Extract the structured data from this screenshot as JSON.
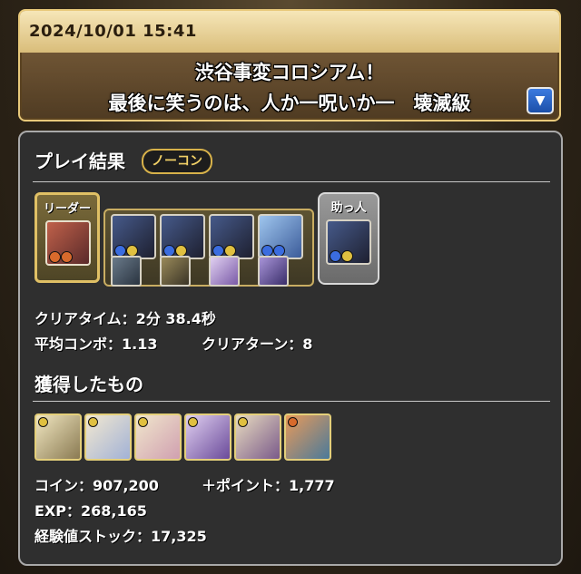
{
  "header": {
    "timestamp": "2024/10/01 15:41",
    "title_line1": "渋谷事変コロシアム！",
    "title_line2": "最後に笑うのは、人か一呪いか一　壊滅級",
    "dropdown_icon": "triangle-down-icon"
  },
  "result": {
    "section_title": "プレイ結果",
    "badge": "ノーコン",
    "leader_label": "リーダー",
    "helper_label": "助っ人",
    "clear_time": "クリアタイム：2分 38.4秒",
    "avg_combo": "平均コンボ：1.13",
    "clear_turns": "クリアターン：8"
  },
  "team": {
    "leader_colors": [
      "#b2563a",
      "#d86a2c"
    ],
    "members_colors": [
      "#3a4a8a",
      "#3a4a8a",
      "#3a4a8a",
      "#6fa0d8"
    ],
    "assist_colors": [
      "#5a6a7a",
      "#8a7a52",
      "#b7a4d6",
      "#6a5aa8"
    ],
    "helper_colors": [
      "#3a4a8a"
    ]
  },
  "drops_section": {
    "section_title": "獲得したもの",
    "coin": "コイン：907,200",
    "plus_points": "＋ポイント：1,777",
    "exp": "EXP：268,165",
    "exp_stock": "経験値ストック：17,325",
    "item_colors": [
      "#e9d9a6",
      "#e8d8b0",
      "#e6d6b4",
      "#b9a6d8",
      "#d8c7a6",
      "#d97a4a"
    ]
  },
  "colors": {
    "gold_border": "#e0c065",
    "panel_bg": "#2f2f2f"
  }
}
